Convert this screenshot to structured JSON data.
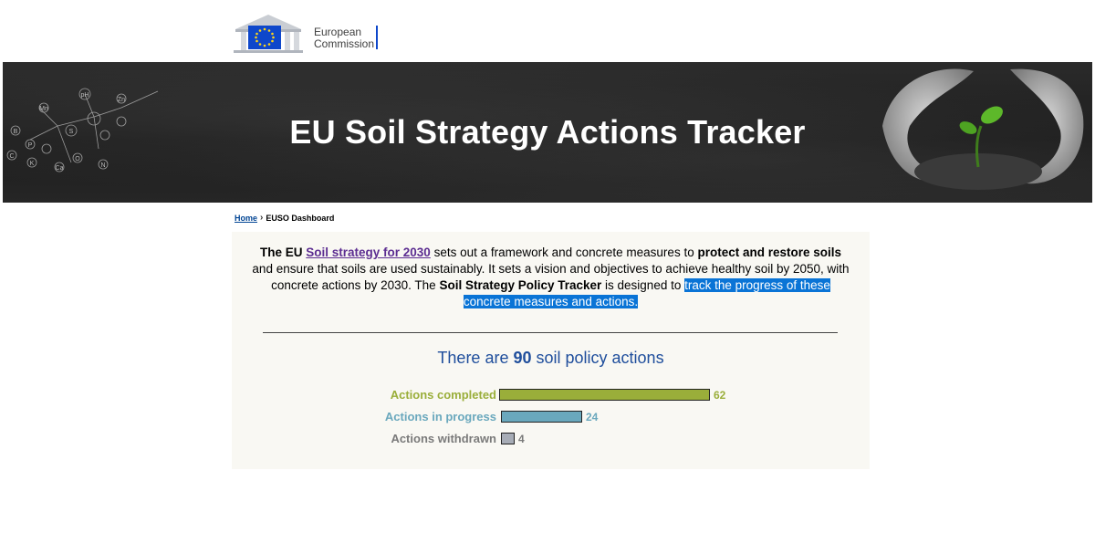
{
  "header": {
    "logo_line1": "European",
    "logo_line2": "Commission"
  },
  "banner": {
    "title": "EU Soil Strategy Actions Tracker"
  },
  "breadcrumb": {
    "home": "Home",
    "current": "EUSO Dashboard"
  },
  "intro": {
    "p1": "The EU ",
    "link": "Soil strategy for 2030",
    "p2": " sets out a framework and concrete measures to ",
    "bold1": "protect and restore soils",
    "p3": " and ensure that soils are used sustainably. It sets a vision and objectives to achieve healthy soil by 2050, with concrete actions by 2030. The ",
    "bold2": "Soil Strategy Policy Tracker",
    "p4": " is designed to ",
    "highlight": "track the progress of these concrete measures and actions."
  },
  "summary": {
    "prefix": "There are ",
    "count": "90",
    "suffix": " soil policy actions"
  },
  "chart_data": {
    "type": "bar",
    "orientation": "horizontal",
    "categories": [
      "Actions completed",
      "Actions in progress",
      "Actions withdrawn"
    ],
    "values": [
      62,
      24,
      4
    ],
    "colors": [
      "#9aae3a",
      "#6aa8bd",
      "#a7acb6"
    ],
    "label_colors": [
      "#9aae3a",
      "#6aa8bd",
      "#7a7a7a"
    ]
  }
}
